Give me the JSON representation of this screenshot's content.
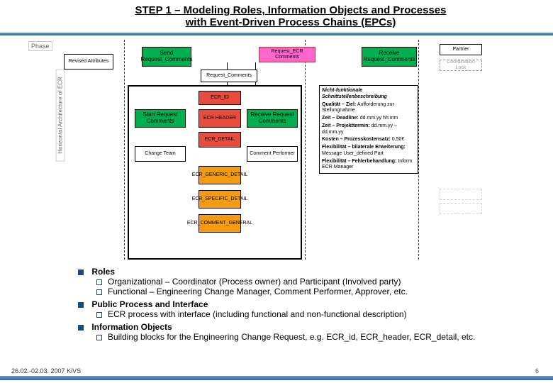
{
  "title": {
    "line1": "STEP 1 – Modeling Roles, Information Objects and Processes",
    "line2": "with Event-Driven Process Chains (EPCs)"
  },
  "diagram": {
    "phase_label": "Phase",
    "vert_label": "Horizontal Architecture of ECR",
    "top_left_white": "Revised Attributes",
    "partner_box": "Partner",
    "center_label_small": "Request_Comments",
    "green_send": "Send Request_Comments",
    "pink_req_ecr": "Request_ECR Comments",
    "green_receive": "Receive Request_Comments",
    "cl_box": "Coordination Lock",
    "red_ecr_id": "ECR_ID",
    "green_start": "Start Request Comments",
    "red_ecr_header": "ECR HEADER",
    "green_receive_req": "Receive Request Comments",
    "red_ecr_detail": "ECR_DETAIL",
    "white_change_team": "Change Team",
    "white_comment_perf": "Comment Performer",
    "orange1": "ECR_GENERIC_DETAIL",
    "orange2": "ECR_SPECIFIC_DETAIL",
    "orange3": "ECR_COMMENT_GENERAL",
    "desc": {
      "header": "Nicht-funktionale Schnittstellenbeschreibung",
      "qual_k": "Qualität – Ziel:",
      "qual_v": "Aufforderung zur Stellungnahme",
      "zeit1_k": "Zeit – Deadline:",
      "zeit1_v": "dd.mm.yy hh:mm",
      "zeit2_k": "Zeit – Projekttermin:",
      "zeit2_v": "dd.mm.yy – dd.mm.yy",
      "kosten_k": "Kosten – Prozesskostensatz:",
      "kosten_v": "0,50€",
      "flex1_k": "Flexibilität – bilaterale Erweiterung:",
      "flex1_v": "Message User_defined Part",
      "flex2_k": "Flexibilität – Fehlerbehandlung:",
      "flex2_v": "Inform ECR Manager"
    }
  },
  "bullets": {
    "roles": "Roles",
    "roles_1": "Organizational – Coordinator (Process owner) and Participant (Involved party)",
    "roles_2": "Functional – Engineering Change Manager, Comment Performer, Approver, etc.",
    "pub": "Public Process and Interface",
    "pub_1": "ECR process with interface (including functional and non-functional description)",
    "info": "Information Objects",
    "info_1": "Building blocks for the Engineering Change Request, e.g. ECR_id, ECR_header, ECR_detail, etc."
  },
  "footer": {
    "date": "26.02.-02.03. 2007 KiVS",
    "page": "6"
  }
}
